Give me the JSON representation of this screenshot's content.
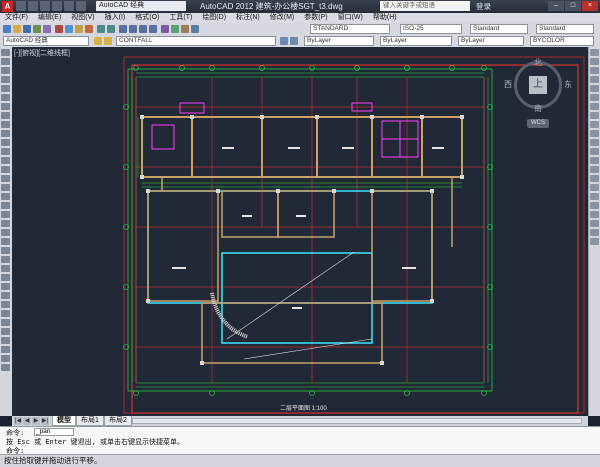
{
  "app": {
    "title": "AutoCAD 2012   建筑-办公楼SGT_t3.dwg",
    "workspace": "AutoCAD 经典",
    "help_search_placeholder": "键入关键字或短语",
    "login": "登录"
  },
  "menu": [
    "文件(F)",
    "编辑(E)",
    "视图(V)",
    "插入(I)",
    "格式(O)",
    "工具(T)",
    "绘图(D)",
    "标注(N)",
    "修改(M)",
    "参数(P)",
    "窗口(W)",
    "帮助(H)"
  ],
  "toolbar": {
    "text_style": "STANDARD",
    "dim_style": "ISO-25",
    "table_style": "Standard",
    "mleader_style": "Standard",
    "workspace_combo": "AutoCAD 经典",
    "layer": "CONTFALL",
    "color": "ByLayer",
    "linetype": "ByLayer",
    "lineweight": "ByLayer",
    "plotstyle": "BYCOLOR"
  },
  "viewport": {
    "label": "[-][俯视][二维线框]",
    "plan_title": "二层平面图",
    "scale_label": "1:100"
  },
  "navcube": {
    "north": "北",
    "south": "南",
    "east": "东",
    "west": "西",
    "face": "上",
    "wcs": "WCS"
  },
  "tabs": {
    "model": "模型",
    "layout1": "布局1",
    "layout2": "布局2"
  },
  "command": {
    "line1": "命令:",
    "line1_input": "_pan",
    "line2": "按 Esc 或 Enter 键退出, 或单击右键显示快捷菜单。",
    "line3": "命令:"
  },
  "status": {
    "text": "按住拾取键并拖动进行平移。"
  },
  "colors": {
    "background": "#212836",
    "axis": "#ff2f2f",
    "dimension": "#2bdf40",
    "wall": "#c9a26a",
    "column": "#d8d8d8",
    "magenta": "#ff40ff",
    "cyan": "#3ee6ff"
  }
}
